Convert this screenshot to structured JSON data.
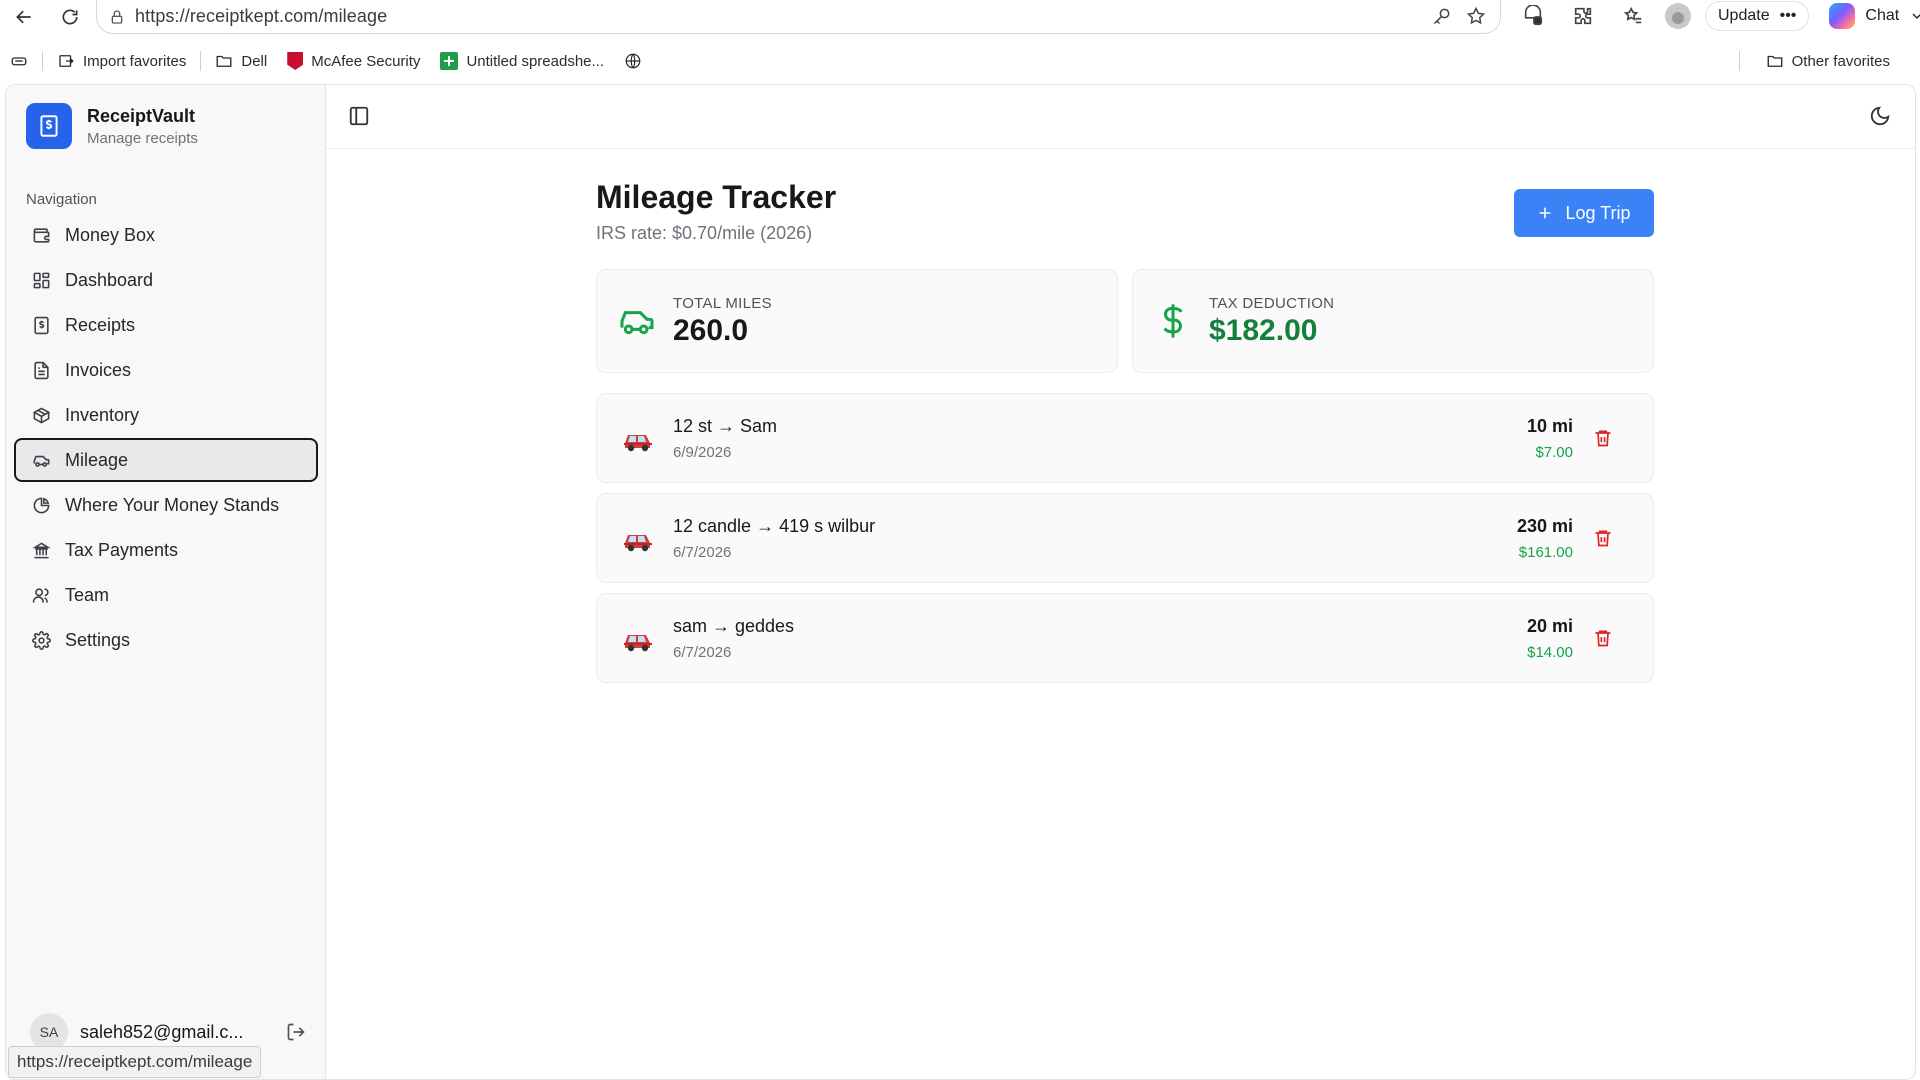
{
  "browser": {
    "url": "https://receiptkept.com/mileage",
    "update_label": "Update",
    "chat_label": "Chat",
    "favorites": [
      {
        "label": "Import favorites"
      },
      {
        "label": "Dell"
      },
      {
        "label": "McAfee Security"
      },
      {
        "label": "Untitled spreadshe..."
      }
    ],
    "other_favorites": "Other favorites",
    "status_url": "https://receiptkept.com/mileage"
  },
  "sidebar": {
    "brand_name": "ReceiptVault",
    "brand_sub": "Manage receipts",
    "nav_title": "Navigation",
    "items": [
      {
        "label": "Money Box",
        "icon": "wallet-icon"
      },
      {
        "label": "Dashboard",
        "icon": "dashboard-icon"
      },
      {
        "label": "Receipts",
        "icon": "receipt-icon"
      },
      {
        "label": "Invoices",
        "icon": "invoice-icon"
      },
      {
        "label": "Inventory",
        "icon": "box-icon"
      },
      {
        "label": "Mileage",
        "icon": "car-icon",
        "active": true
      },
      {
        "label": "Where Your Money Stands",
        "icon": "pie-chart-icon"
      },
      {
        "label": "Tax Payments",
        "icon": "bank-icon"
      },
      {
        "label": "Team",
        "icon": "users-icon"
      },
      {
        "label": "Settings",
        "icon": "gear-icon"
      }
    ],
    "user_initials": "SA",
    "user_email": "saleh852@gmail.c..."
  },
  "main": {
    "title": "Mileage Tracker",
    "subtitle": "IRS rate: $0.70/mile (2026)",
    "log_trip_label": "Log Trip",
    "stats": {
      "total_miles_label": "TOTAL MILES",
      "total_miles_value": "260.0",
      "tax_deduction_label": "TAX DEDUCTION",
      "tax_deduction_value": "$182.00"
    },
    "trips": [
      {
        "route": "12 st → Sam",
        "date": "6/9/2026",
        "miles": "10 mi",
        "amount": "$7.00"
      },
      {
        "route": "12 candle → 419 s wilbur",
        "date": "6/7/2026",
        "miles": "230 mi",
        "amount": "$161.00"
      },
      {
        "route": "sam → geddes",
        "date": "6/7/2026",
        "miles": "20 mi",
        "amount": "$14.00"
      }
    ]
  },
  "colors": {
    "accent": "#3b82f6",
    "brand": "#2563eb",
    "money_green": "#16a34a",
    "delete_red": "#dc2626"
  }
}
